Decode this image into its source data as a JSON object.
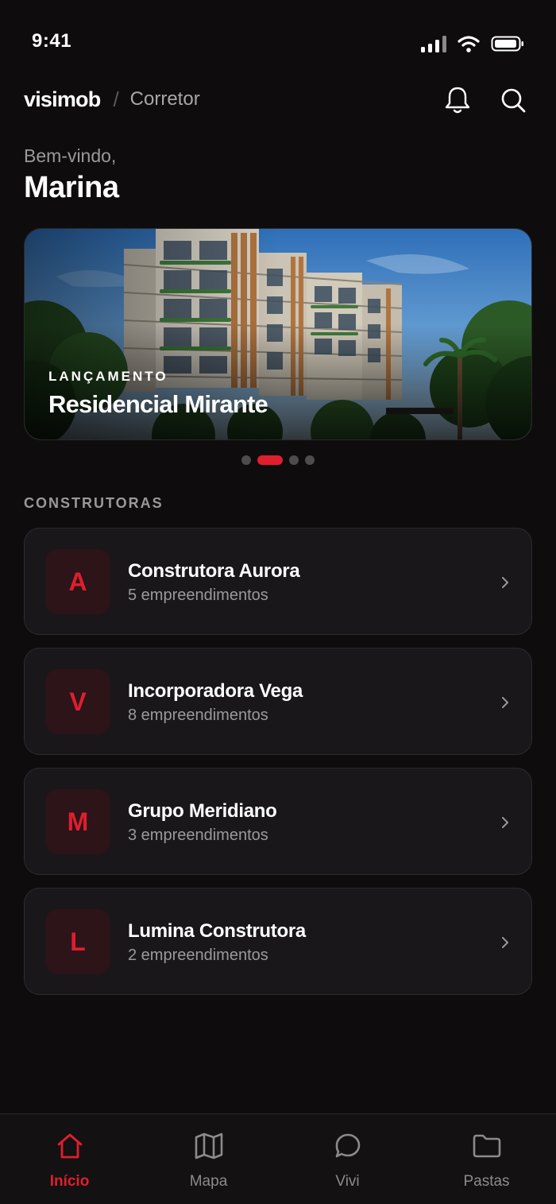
{
  "status": {
    "time": "9:41"
  },
  "header": {
    "logo": "visimob",
    "separator": "/",
    "role": "Corretor"
  },
  "welcome": {
    "greeting": "Bem-vindo,",
    "name": "Marina"
  },
  "hero": {
    "tag": "LANÇAMENTO",
    "title": "Residencial Mirante",
    "slides": 4,
    "active_slide": 2
  },
  "section": {
    "title": "CONSTRUTORAS"
  },
  "builders": [
    {
      "initial": "A",
      "name": "Construtora Aurora",
      "count": "5 empreendimentos"
    },
    {
      "initial": "V",
      "name": "Incorporadora Vega",
      "count": "8 empreendimentos"
    },
    {
      "initial": "M",
      "name": "Grupo Meridiano",
      "count": "3 empreendimentos"
    },
    {
      "initial": "L",
      "name": "Lumina Construtora",
      "count": "2 empreendimentos"
    }
  ],
  "tabs": [
    {
      "label": "Início",
      "icon": "home-icon",
      "active": true
    },
    {
      "label": "Mapa",
      "icon": "map-icon",
      "active": false
    },
    {
      "label": "Vivi",
      "icon": "chat-icon",
      "active": false
    },
    {
      "label": "Pastas",
      "icon": "folder-icon",
      "active": false
    }
  ],
  "colors": {
    "accent": "#e01e2e",
    "background": "#0e0c0d",
    "card": "#19171a"
  }
}
